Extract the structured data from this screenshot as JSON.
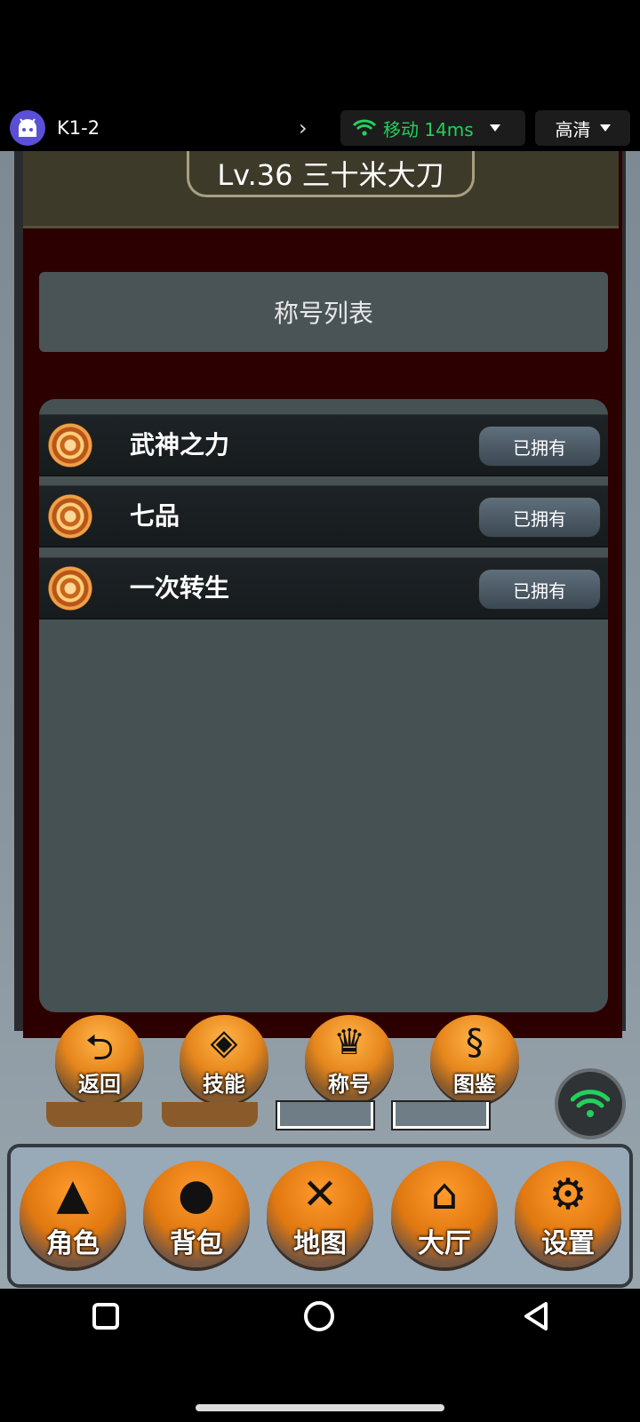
{
  "status_bar": {
    "app_title": "K1-2",
    "network_label": "移动 14ms",
    "quality_label": "高清"
  },
  "header": {
    "level_title": "Lv.36 三十米大刀"
  },
  "panel": {
    "title": "称号列表"
  },
  "titles": [
    {
      "name": "武神之力",
      "status": "已拥有"
    },
    {
      "name": "七品",
      "status": "已拥有"
    },
    {
      "name": "一次转生",
      "status": "已拥有"
    }
  ],
  "sub_menu": [
    {
      "label": "返回",
      "icon": "back-arrow-icon"
    },
    {
      "label": "技能",
      "icon": "skill-icon"
    },
    {
      "label": "称号",
      "icon": "crown-icon"
    },
    {
      "label": "图鉴",
      "icon": "dragon-icon"
    }
  ],
  "dock": [
    {
      "label": "角色",
      "icon": "wizard-icon"
    },
    {
      "label": "背包",
      "icon": "bag-icon"
    },
    {
      "label": "地图",
      "icon": "crossed-swords-icon"
    },
    {
      "label": "大厅",
      "icon": "house-icon"
    },
    {
      "label": "设置",
      "icon": "gears-icon"
    }
  ],
  "colors": {
    "accent_green": "#22d15c",
    "orange": "#e6861c",
    "dark_red_panel": "#2d0000"
  }
}
